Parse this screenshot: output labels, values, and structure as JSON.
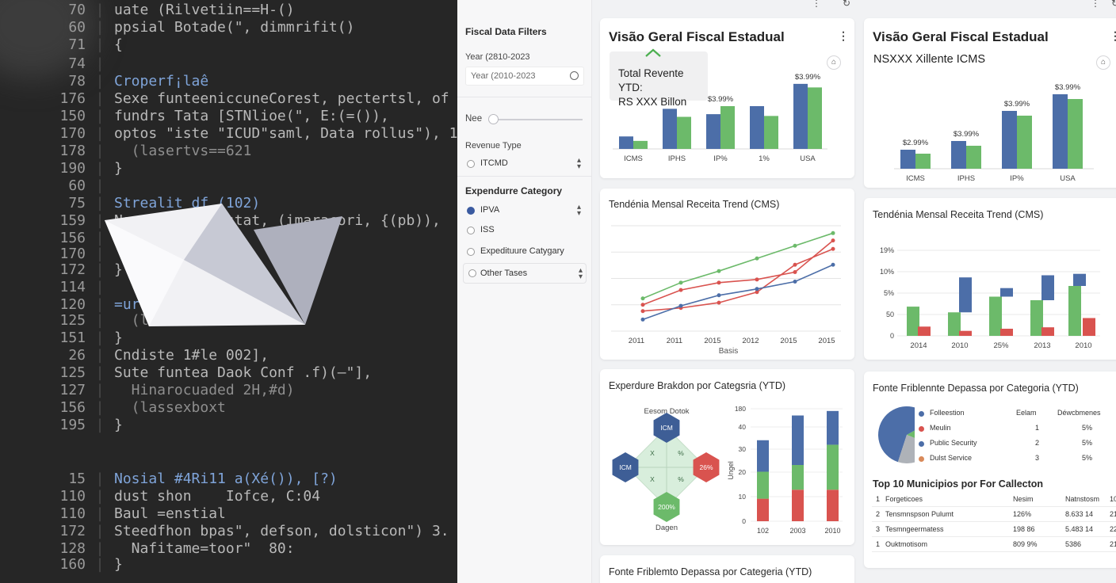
{
  "code_editor": {
    "lines": [
      {
        "ln": "70",
        "text": "uate (Rilvetiin==H-()",
        "style": "plain"
      },
      {
        "ln": "60",
        "text": "ppsial Botade(\", dimmrifit()",
        "style": "plain"
      },
      {
        "ln": "71",
        "text": "{",
        "style": "plain"
      },
      {
        "ln": "74",
        "text": "",
        "style": "plain"
      },
      {
        "ln": "78",
        "text": "Croperf¡laê",
        "style": "kw"
      },
      {
        "ln": "176",
        "text": "Sexe funteeniccuneCorest, pectertsl, of 1",
        "style": "plain"
      },
      {
        "ln": "150",
        "text": "fundrs Tata [STNlioe(\", E:(=()),",
        "style": "plain"
      },
      {
        "ln": "170",
        "text": "optos \"iste \"ICUD\"saml, Data rollus\"), 1",
        "style": "plain"
      },
      {
        "ln": "178",
        "text": "  (lasertvs==621",
        "style": "dim"
      },
      {
        "ln": "190",
        "text": "}",
        "style": "plain"
      },
      {
        "ln": "60",
        "text": "",
        "style": "plain"
      },
      {
        "ln": "75",
        "text": "Strealit df (102)",
        "style": "kw"
      },
      {
        "ln": "159",
        "text": "Naxce Norai  stat, (imaracori, {(pb)),",
        "style": "plain"
      },
      {
        "ln": "156",
        "text": "  teerors",
        "style": "dim"
      },
      {
        "ln": "170",
        "text": "",
        "style": "plain"
      },
      {
        "ln": "172",
        "text": "}",
        "style": "plain"
      },
      {
        "ln": "114",
        "text": "",
        "style": "plain"
      },
      {
        "ln": "120",
        "text": "=ur",
        "style": "kw"
      },
      {
        "ln": "125",
        "text": "  (l",
        "style": "dim"
      },
      {
        "ln": "151",
        "text": "}",
        "style": "plain"
      },
      {
        "ln": "26",
        "text": "Cndiste 1#le 002],",
        "style": "plain"
      },
      {
        "ln": "125",
        "text": "Sute funtea Daok Conf .f)(—\"],",
        "style": "plain"
      },
      {
        "ln": "127",
        "text": "  Hinarocuaded 2H,#d)",
        "style": "dim"
      },
      {
        "ln": "156",
        "text": "  (lassexboxt",
        "style": "dim"
      },
      {
        "ln": "195",
        "text": "}",
        "style": "plain"
      },
      {
        "ln": "15",
        "text": "Nosial #4Ri11 a(Xé()), [?)",
        "style": "kw"
      },
      {
        "ln": "110",
        "text": "dust shon    Iofce, C:04",
        "style": "plain"
      },
      {
        "ln": "110",
        "text": "Baul =enstial",
        "style": "plain"
      },
      {
        "ln": "172",
        "text": "Steedfhon bpas\", defson, dolsticon\") 3.",
        "style": "plain"
      },
      {
        "ln": "128",
        "text": "  Nafitame=toor\"  80:",
        "style": "plain"
      },
      {
        "ln": "160",
        "text": "}",
        "style": "plain"
      }
    ]
  },
  "sidebar": {
    "title": "Fiscal Data Filters",
    "year_label": "Year (2810-2023",
    "year_value": "Year (2010-2023",
    "slider_label": "Nee",
    "slider_value": 0,
    "revenue_type_label": "Revenue Type",
    "revenue_option": "ITCMD",
    "expenditure_label": "Expendurre Category",
    "expenditure_options": [
      {
        "label": "IPVA",
        "selected": true
      },
      {
        "label": "ISS",
        "selected": false
      },
      {
        "label": "Expedituure Catygary",
        "selected": false
      },
      {
        "label": "Other Tases",
        "selected": false
      }
    ]
  },
  "cards": {
    "overview_a": {
      "title": "Visão Geral Fiscal Estadual",
      "kpi_line1": "Total Revente YTD:",
      "kpi_line2": "RS XXX Billon",
      "chart": {
        "type": "bar",
        "categories": [
          "ICMS",
          "IPHS",
          "IP%",
          "1%",
          "USA"
        ],
        "series": [
          {
            "values": [
              1.4,
              4.5,
              3.9,
              4.8,
              7.3
            ]
          },
          {
            "values": [
              0.9,
              3.6,
              4.8,
              3.7,
              6.9
            ]
          }
        ],
        "bar_labels": [
          "",
          "",
          "$3.99%",
          "",
          "$3.99%"
        ],
        "ylim": [
          0,
          8
        ]
      }
    },
    "overview_b": {
      "title": "Visão Geral Fiscal Estadual",
      "subtitle": "NSXXX Xillente ICMS",
      "chart": {
        "type": "bar",
        "categories": [
          "ICMS",
          "IPHS",
          "IP%",
          "USA"
        ],
        "series": [
          {
            "values": [
              2.4,
              3.5,
              7.3,
              9.4
            ]
          },
          {
            "values": [
              1.9,
              2.9,
              6.7,
              8.8
            ]
          }
        ],
        "bar_labels": [
          "$2.99%",
          "$3.99%",
          "$3.99%",
          "$3.99%"
        ],
        "ylim": [
          0,
          10
        ]
      }
    },
    "trend_line": {
      "title": "Tendénia Mensal Receita Trend (CMS)",
      "chart": {
        "type": "line",
        "categories": [
          "2011",
          "2011",
          "2015",
          "2012",
          "2015",
          "2015"
        ],
        "xlabel": "Basis",
        "series": [
          {
            "color": "#6cba6a",
            "values": [
              3.1,
              4.6,
              5.7,
              6.9,
              8.1,
              9.3
            ]
          },
          {
            "color": "#d9534f",
            "values": [
              2.5,
              3.9,
              4.6,
              4.9,
              5.6,
              8.6
            ]
          },
          {
            "color": "#d9534f",
            "values": [
              1.9,
              2.2,
              2.7,
              3.7,
              6.3,
              7.8
            ]
          },
          {
            "color": "#4c6ea8",
            "values": [
              1.1,
              2.4,
              3.4,
              4.0,
              4.7,
              6.3
            ]
          }
        ],
        "ylim": [
          0,
          10
        ]
      }
    },
    "trend_stacked": {
      "title": "Tendénia Mensal Receita Trend (CMS)",
      "chart": {
        "type": "bar",
        "categories": [
          "2014",
          "2010",
          "25%",
          "2013",
          "2010"
        ],
        "yticks": [
          "0",
          "50",
          "5%",
          "10%",
          "19%"
        ],
        "series": [
          {
            "name": "",
            "values": [
              4.1,
              3.3,
              5.5,
              5.0,
              7.0
            ]
          },
          {
            "name": "",
            "values": [
              0,
              4.9,
              1.2,
              3.5,
              1.7
            ]
          }
        ],
        "red_values": [
          1.3,
          0.7,
          1.0,
          1.2,
          2.5
        ],
        "ylim": [
          0,
          12
        ]
      }
    },
    "breakdown": {
      "title": "Experdure Brakdon por Categsria (YTD)",
      "diagram_title": "Eesom Dotok",
      "diagram_caption": "Dagen",
      "nodes": [
        "ICM",
        "ICM",
        "26%",
        "200%"
      ],
      "inner": [
        "X",
        "%",
        "X",
        "%"
      ],
      "chart": {
        "type": "bar",
        "categories": [
          "102",
          "2003",
          "2010"
        ],
        "ylabel": "Ungel",
        "yticks": [
          "0",
          "10",
          "20",
          "30",
          "40",
          "180"
        ],
        "stack_red": [
          10,
          14,
          14
        ],
        "stack_green": [
          12,
          11,
          20
        ],
        "stack_blue": [
          14,
          22,
          15
        ],
        "ylim": [
          0,
          50
        ]
      }
    },
    "fonte_pie": {
      "title": "Fonte Friblennte Depassa por Categoria (YTD)",
      "legend_headers": [
        "Eelam",
        "Déwcbmenes"
      ],
      "legend": [
        {
          "label": "Folleestion",
          "color": "#4c6ea8",
          "c1": "",
          "c2": "",
          "c3": ""
        },
        {
          "label": "Meulin",
          "color": "#d9534f",
          "c1": "1",
          "c2": "5%",
          "c3": "8"
        },
        {
          "label": "Public Security",
          "color": "#4c6ea8",
          "c1": "2",
          "c2": "5%",
          "c3": "1"
        },
        {
          "label": "Dulst Service",
          "color": "#d98a5a",
          "c1": "3",
          "c2": "5%",
          "c3": "1"
        }
      ],
      "pie": [
        {
          "color": "#4c6ea8",
          "value": 62
        },
        {
          "color": "#6cba6a",
          "value": 14
        },
        {
          "color": "#aeb2b8",
          "value": 24
        }
      ],
      "table_title": "Top 10 Municipios por For Callecton",
      "table_header": [
        "1",
        "Forgeticoes",
        "Nesim",
        "Natnstosm",
        "10"
      ],
      "table_rows": [
        [
          "2",
          "Tensmnspson Pulumt",
          "126%",
          "8.633 14",
          "21"
        ],
        [
          "3",
          "Tesmngeermatess",
          "198 86",
          "5.483 14",
          "22"
        ],
        [
          "1",
          "Ouktmotisom",
          "809 9%",
          "5386",
          "21"
        ]
      ]
    },
    "fonte_bottom": {
      "title": "Fonte Friblemto Depassa por Categeria (YTD)"
    }
  }
}
